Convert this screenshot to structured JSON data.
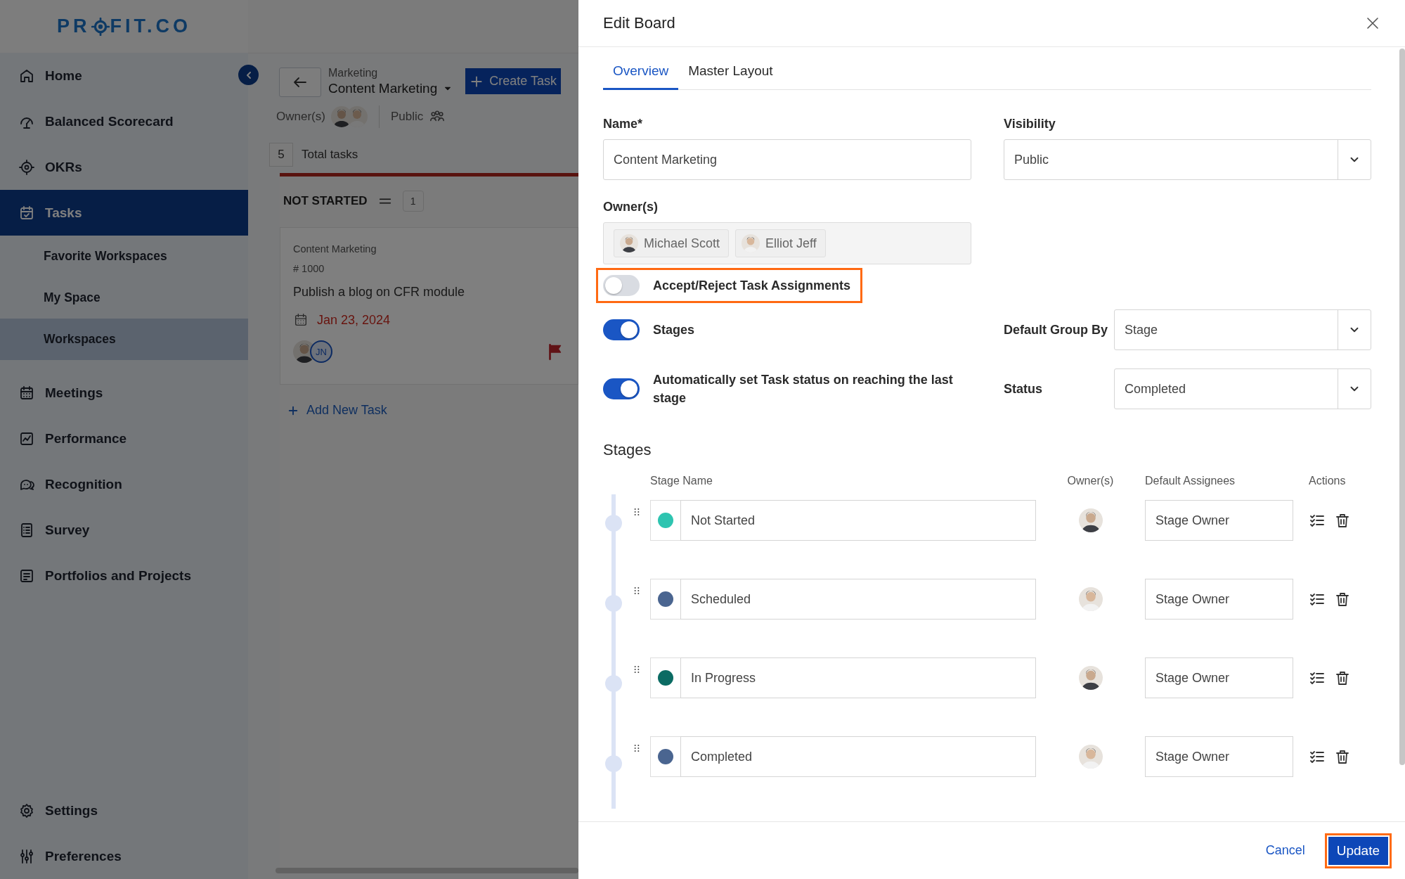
{
  "logo": {
    "start": "PR",
    "end": "FIT.CO"
  },
  "sidebar": {
    "items": [
      {
        "label": "Home",
        "selected": false
      },
      {
        "label": "Balanced Scorecard",
        "selected": false
      },
      {
        "label": "OKRs",
        "selected": false
      },
      {
        "label": "Tasks",
        "selected": true,
        "children": [
          {
            "label": "Favorite Workspaces",
            "selected": false
          },
          {
            "label": "My Space",
            "selected": false
          },
          {
            "label": "Workspaces",
            "selected": true
          }
        ]
      },
      {
        "label": "Meetings",
        "selected": false
      },
      {
        "label": "Performance",
        "selected": false
      },
      {
        "label": "Recognition",
        "selected": false
      },
      {
        "label": "Survey",
        "selected": false
      },
      {
        "label": "Portfolios and Projects",
        "selected": false
      }
    ],
    "bottom_items": [
      {
        "label": "Settings",
        "selected": false
      },
      {
        "label": "Preferences",
        "selected": false
      }
    ]
  },
  "board": {
    "breadcrumb": "Marketing",
    "title": "Content Marketing",
    "create_button": "Create Task",
    "owners_label": "Owner(s)",
    "visibility": "Public",
    "total_count": "5",
    "total_label": "Total tasks",
    "column": {
      "title": "NOT STARTED",
      "count": "1",
      "add_label": "Add New Task",
      "cards": [
        {
          "project": "Content Marketing",
          "number": "# 1000",
          "title": "Publish a blog on CFR module",
          "due": "Jan 23, 2024",
          "assignee_initials": "JN"
        }
      ]
    }
  },
  "dialog": {
    "title": "Edit Board",
    "tabs": [
      {
        "label": "Overview",
        "selected": true
      },
      {
        "label": "Master Layout",
        "selected": false
      }
    ],
    "name": {
      "label": "Name*",
      "value": "Content Marketing"
    },
    "visibility": {
      "label": "Visibility",
      "value": "Public"
    },
    "owners": {
      "label": "Owner(s)",
      "chips": [
        "Michael Scott",
        "Elliot Jeff"
      ]
    },
    "toggles": [
      {
        "label": "Accept/Reject Task Assignments",
        "on": false,
        "highlighted": true
      },
      {
        "label": "Stages",
        "on": true,
        "highlighted": false,
        "select": {
          "label": "Default Group By",
          "value": "Stage"
        }
      },
      {
        "label": "Automatically set Task status on reaching the last stage",
        "on": true,
        "highlighted": false,
        "select": {
          "label": "Status",
          "value": "Completed"
        }
      }
    ],
    "stages": {
      "title": "Stages",
      "columns": [
        "Stage Name",
        "Owner(s)",
        "Default Assignees",
        "Actions"
      ],
      "rows": [
        {
          "name": "Not Started",
          "color": "#2ec4b0",
          "assignee": "Stage Owner"
        },
        {
          "name": "Scheduled",
          "color": "#4a6590",
          "assignee": "Stage Owner"
        },
        {
          "name": "In Progress",
          "color": "#0b6b63",
          "assignee": "Stage Owner"
        },
        {
          "name": "Completed",
          "color": "#4a6590",
          "assignee": "Stage Owner"
        }
      ]
    },
    "cancel": "Cancel",
    "update": {
      "label": "Update",
      "highlighted": true
    }
  }
}
